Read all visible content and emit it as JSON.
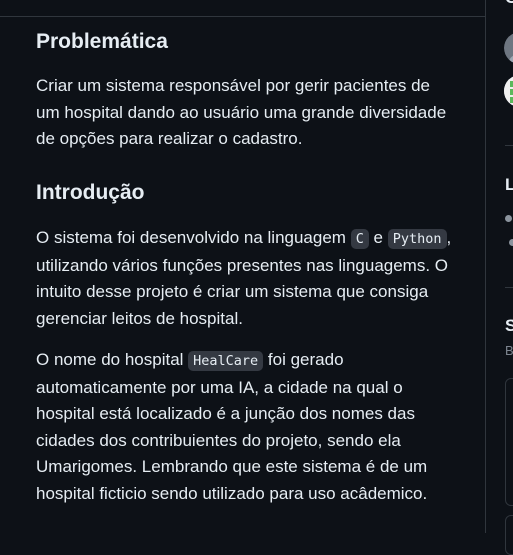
{
  "readme": {
    "section_problem": {
      "heading": "Problemática",
      "text": "Criar um sistema responsável por gerir pacientes de um hospital dando ao usuário uma grande diversidade de opções para realizar o cadastro."
    },
    "section_intro": {
      "heading": "Introdução",
      "p1_a": "O sistema foi desenvolvido na linguagem ",
      "p1_code1": "C",
      "p1_b": " e ",
      "p1_code2": "Python",
      "p1_c": ", utilizando vários funções presentes nas linguagems. O intuito desse projeto é criar um sistema que consiga gerenciar leitos de hospital.",
      "p2_a": "O nome do hospital ",
      "p2_code": "HealCare",
      "p2_b": " foi gerado automaticamente por uma IA, a cidade na qual o hospital está localizado é a junção dos nomes das cidades dos contribuientes do projeto, sendo ela Umarigomes. Lembrando que este sistema é de um hospital ficticio sendo utilizado para uso acâdemico."
    }
  },
  "sidebar": {
    "contributors_letter": "C",
    "languages_letter": "L",
    "suggested_letter": "S",
    "suggested_sub": "B"
  }
}
